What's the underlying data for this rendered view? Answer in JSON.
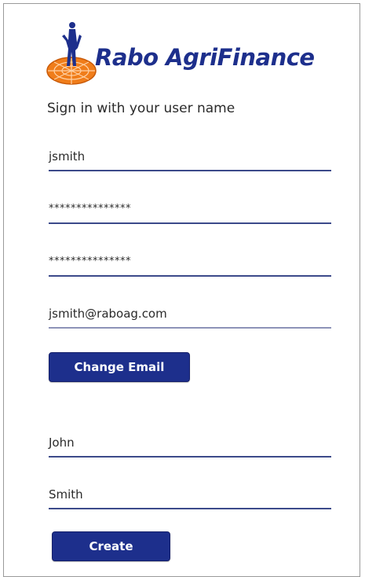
{
  "brand": {
    "name": "Rabo AgriFinance",
    "logo_icon": "rabobank-figure-globe-icon",
    "color": "#1d2f8c",
    "accent": "#f07d1a"
  },
  "signin": {
    "heading": "Sign in with your user name"
  },
  "fields": {
    "username": "jsmith",
    "password": "***************",
    "confirm_password": "***************",
    "email": "jsmith@raboag.com",
    "first_name": "John",
    "last_name": "Smith"
  },
  "buttons": {
    "change_email": "Change Email",
    "create": "Create"
  }
}
